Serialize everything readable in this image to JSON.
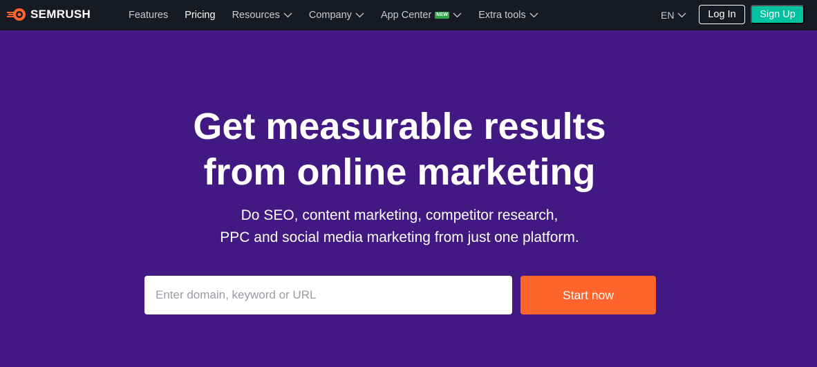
{
  "brand": {
    "name": "SEMRUSH",
    "accent": "#ff642d"
  },
  "nav": {
    "items": [
      {
        "label": "Features",
        "dropdown": false
      },
      {
        "label": "Pricing",
        "dropdown": false,
        "active": true
      },
      {
        "label": "Resources",
        "dropdown": true
      },
      {
        "label": "Company",
        "dropdown": true
      },
      {
        "label": "App Center",
        "dropdown": true,
        "badge": "NEW"
      },
      {
        "label": "Extra tools",
        "dropdown": true
      }
    ],
    "language": "EN",
    "login_label": "Log In",
    "signup_label": "Sign Up"
  },
  "hero": {
    "title_line1": "Get measurable results",
    "title_line2": "from online marketing",
    "subtitle_line1": "Do SEO, content marketing, competitor research,",
    "subtitle_line2": "PPC and social media marketing from just one platform."
  },
  "search": {
    "placeholder": "Enter domain, keyword or URL",
    "button_label": "Start now"
  },
  "colors": {
    "topbar": "#171a22",
    "hero_bg": "#421983",
    "signup": "#00c2a0",
    "cta": "#ff642d",
    "badge": "#2fa34a"
  }
}
